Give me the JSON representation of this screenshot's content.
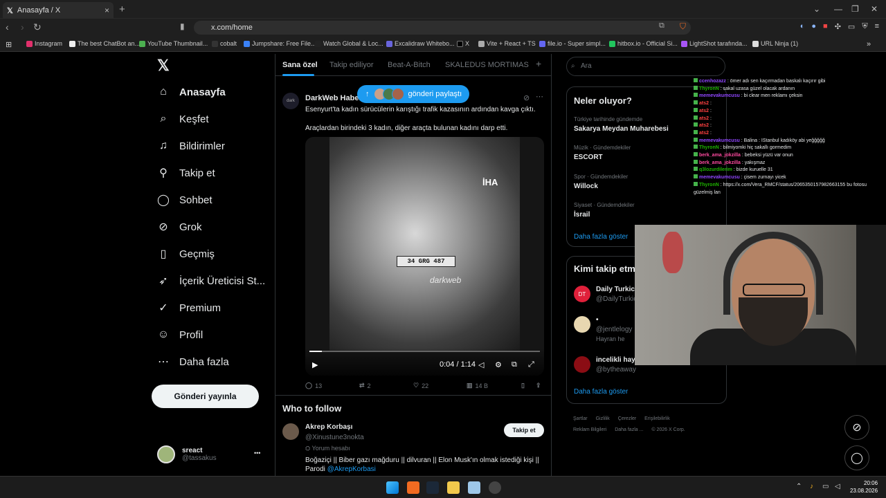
{
  "browser": {
    "tab_title": "Anasayfa / X",
    "tab_close": "×",
    "new_tab": "+",
    "url": "x.com/home",
    "bookmarks": [
      "Instagram",
      "The best ChatBot an...",
      "YouTube Thumbnail...",
      "cobalt",
      "Jumpshare: Free File...",
      "Watch Global & Loc...",
      "Excalidraw Whitebo...",
      "X",
      "Vite + React + TS",
      "file.io - Super simpl...",
      "hitbox.io - Official Si...",
      "LightShot tarafında...",
      "URL Ninja (1)"
    ]
  },
  "sidebar": {
    "logo": "𝕏",
    "items": [
      {
        "label": "Anasayfa",
        "icon": "home-icon",
        "glyph": "⌂"
      },
      {
        "label": "Keşfet",
        "icon": "search-icon",
        "glyph": "⌕"
      },
      {
        "label": "Bildirimler",
        "icon": "bell-icon",
        "glyph": "♫"
      },
      {
        "label": "Takip et",
        "icon": "person-add-icon",
        "glyph": "⚲"
      },
      {
        "label": "Sohbet",
        "icon": "chat-icon",
        "glyph": "◯"
      },
      {
        "label": "Grok",
        "icon": "grok-icon",
        "glyph": "⊘"
      },
      {
        "label": "Geçmiş",
        "icon": "bookmark-icon",
        "glyph": "▯"
      },
      {
        "label": "İçerik Üreticisi St...",
        "icon": "rocket-icon",
        "glyph": "➶"
      },
      {
        "label": "Premium",
        "icon": "verified-icon",
        "glyph": "✓"
      },
      {
        "label": "Profil",
        "icon": "profile-icon",
        "glyph": "☺"
      },
      {
        "label": "Daha fazla",
        "icon": "more-icon",
        "glyph": "⋯"
      }
    ],
    "post_button": "Gönderi yayınla",
    "account_name": "sreact",
    "account_handle": "@tassakus",
    "account_menu": "•••"
  },
  "feed": {
    "tabs": [
      "Sana özel",
      "Takip ediliyor",
      "Beat-A-Bitch",
      "SKALEDUS MORTIMAS"
    ],
    "add_tab": "+",
    "new_posts_pill": "gönderi paylaştı",
    "tweet": {
      "author": "DarkWeb Haber",
      "logo_text": "dark",
      "line1": "Esenyurt'ta kadın sürücülerin karıştığı trafik kazasının ardından kavga çıktı.",
      "line2": "Araçlardan birindeki 3 kadın, diğer araçta bulunan kadını darp etti.",
      "video": {
        "plate": "34 GRG 487",
        "watermark_iha": "İHA",
        "watermark_dw": "darkweb",
        "time": "0:04 / 1:14",
        "progress": 0.054
      },
      "replies": "13",
      "reposts": "2",
      "likes": "22",
      "views": "14 B"
    },
    "who_to_follow": {
      "title": "Who to follow",
      "name": "Akrep Korbaşı",
      "handle": "@Xinustune3nokta",
      "review": "Yorum hesabı",
      "bio": "Boğaziçi || Biber gazı mağduru || dilvuran || Elon Musk'ın olmak istediği kişi || Parodi ",
      "bio_link": "@AkrepKorbasi",
      "follow_button": "Takip et"
    }
  },
  "right": {
    "search_placeholder": "Ara",
    "trends_title": "Neler oluyor?",
    "trends": [
      {
        "context": "Türkiye tarihinde gündemde",
        "topic": "Sakarya Meydan Muharebesi"
      },
      {
        "context": "Müzik · Gündemdekiler",
        "topic": "ESCORT"
      },
      {
        "context": "Spor · Gündemdekiler",
        "topic": "Willock"
      },
      {
        "context": "Siyaset · Gündemdekiler",
        "topic": "İsrail"
      }
    ],
    "show_more": "Daha fazla göster",
    "follow_title": "Kimi takip etm",
    "follow": [
      {
        "name": "Daily Turkic",
        "handle": "@DailyTurkic",
        "extra": "",
        "color": "#e0203a"
      },
      {
        "name": "•",
        "handle": "@jentlelogy",
        "extra": "Hayran he",
        "color": "#e8d7b0"
      },
      {
        "name": "incelikli hay",
        "handle": "@bytheaway",
        "extra": "",
        "color": "#8b0d14"
      }
    ],
    "follow_btn": "Takip et",
    "show_more2": "Daha fazla göster",
    "footer": [
      "Şartlar",
      "Gizlilik",
      "Çerezler",
      "Erişilebilirlik",
      "Reklam Bilgileri",
      "Daha fazla ...",
      "© 2026 X Corp."
    ]
  },
  "chat": [
    {
      "user": "ccenhozazz",
      "msg": ": ömer adı sen kaçırmadan baskalı kaçırır gibi",
      "color": "#9147ff"
    },
    {
      "user": "ThyronN",
      "msg": ": sakal uzasa güzel olacak ardanın",
      "color": "#1eb400"
    },
    {
      "user": "memevakumcusu",
      "msg": ": bi clear men reklamı çeksin",
      "color": "#9147ff"
    },
    {
      "user": "ats2",
      "msg": ":",
      "color": "#ff4040"
    },
    {
      "user": "ats2",
      "msg": ":",
      "color": "#ff4040"
    },
    {
      "user": "ats2",
      "msg": ":",
      "color": "#ff4040"
    },
    {
      "user": "ats2",
      "msg": ":",
      "color": "#ff4040"
    },
    {
      "user": "ats2",
      "msg": ":",
      "color": "#ff4040"
    },
    {
      "user": "memevakumcusu",
      "msg": ": Balina : İStanbul kadıköy abi yeğğğğğ",
      "color": "#9147ff"
    },
    {
      "user": "ThyronN",
      "msg": ": bilmiyomki hiç sakallı gormedim",
      "color": "#1eb400"
    },
    {
      "user": "berk_ama_jokzilla",
      "msg": ": bebeksi yüzü var onun",
      "color": "#ff4aa0"
    },
    {
      "user": "berk_ama_jokzilla",
      "msg": ": yakışmaz",
      "color": "#ff4aa0"
    },
    {
      "user": "q3lozurdilerim",
      "msg": ": bizde kuruelle 31",
      "color": "#1eb400"
    },
    {
      "user": "memevakumcusu",
      "msg": ": çisem zurnayı yicek",
      "color": "#9147ff"
    },
    {
      "user": "ThyronN",
      "msg": ": https://x.com/Vera_RMCF/status/2065350157982663155 bu fotosu",
      "color": "#1eb400"
    },
    {
      "user": "",
      "msg": "güzelmiş lan",
      "color": "#ffffff"
    }
  ],
  "taskbar": {
    "time": "20:06",
    "date": "23.08.2026"
  },
  "accent": "#1d9bf0"
}
